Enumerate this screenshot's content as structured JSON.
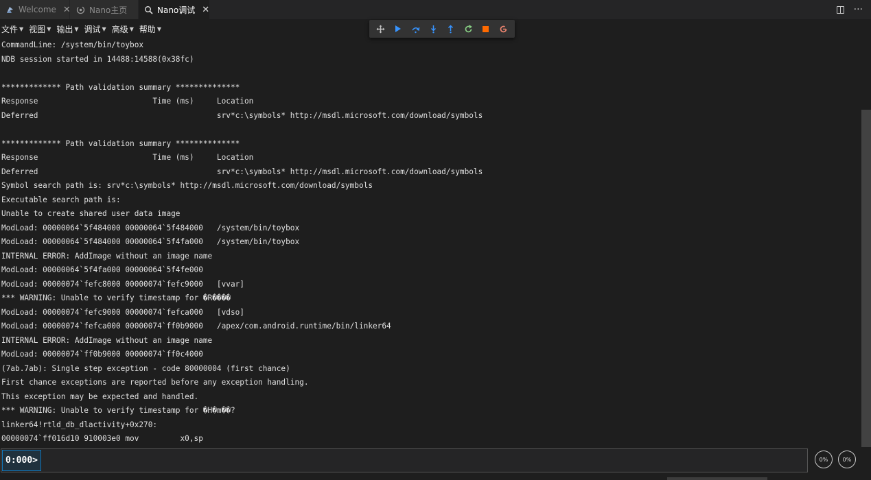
{
  "tabs": [
    {
      "label": "Welcome",
      "icon": "app-icon",
      "closable": true
    },
    {
      "label": "Nano主页",
      "icon": "home-swirl-icon",
      "closable": false
    },
    {
      "label": "Nano调试",
      "icon": "debug-search-icon",
      "closable": true
    }
  ],
  "tabbar_actions": {
    "more": "···"
  },
  "menu": [
    {
      "label": "文件"
    },
    {
      "label": "视图"
    },
    {
      "label": "输出"
    },
    {
      "label": "调试"
    },
    {
      "label": "高级"
    },
    {
      "label": "帮助"
    }
  ],
  "debug_toolbar": {
    "icons": [
      "drag-handle-icon",
      "continue-icon",
      "step-over-icon",
      "step-into-icon",
      "step-out-icon",
      "restart-icon",
      "stop-icon",
      "disconnect-icon"
    ],
    "colors": {
      "blue": "#3794ff",
      "green": "#89d185",
      "orange": "#ff6a00"
    }
  },
  "console": {
    "lines": [
      "CommandLine: /system/bin/toybox",
      "NDB session started in 14488:14588(0x38fc)",
      "",
      "************* Path validation summary **************",
      "Response                         Time (ms)     Location",
      "Deferred                                       srv*c:\\symbols* http://msdl.microsoft.com/download/symbols",
      "",
      "************* Path validation summary **************",
      "Response                         Time (ms)     Location",
      "Deferred                                       srv*c:\\symbols* http://msdl.microsoft.com/download/symbols",
      "Symbol search path is: srv*c:\\symbols* http://msdl.microsoft.com/download/symbols",
      "Executable search path is:",
      "Unable to create shared user data image",
      "ModLoad: 00000064`5f484000 00000064`5f484000   /system/bin/toybox",
      "ModLoad: 00000064`5f484000 00000064`5f4fa000   /system/bin/toybox",
      "INTERNAL ERROR: AddImage without an image name",
      "ModLoad: 00000064`5f4fa000 00000064`5f4fe000",
      "ModLoad: 00000074`fefc8000 00000074`fefc9000   [vvar]",
      "*** WARNING: Unable to verify timestamp for �R����",
      "ModLoad: 00000074`fefc9000 00000074`fefca000   [vdso]",
      "ModLoad: 00000074`fefca000 00000074`ff0b9000   /apex/com.android.runtime/bin/linker64",
      "INTERNAL ERROR: AddImage without an image name",
      "ModLoad: 00000074`ff0b9000 00000074`ff0c4000",
      "(7ab.7ab): Single step exception - code 80000004 (first chance)",
      "First chance exceptions are reported before any exception handling.",
      "This exception may be expected and handled.",
      "*** WARNING: Unable to verify timestamp for �H�m��?",
      "linker64!rtld_db_dlactivity+0x270:",
      "00000074`ff016d10 910003e0 mov         x0,sp"
    ]
  },
  "command": {
    "prompt": "0:000>",
    "value": "",
    "placeholder": ""
  },
  "gauges": [
    {
      "label": "0%",
      "value": 0
    },
    {
      "label": "0%",
      "value": 0
    }
  ]
}
